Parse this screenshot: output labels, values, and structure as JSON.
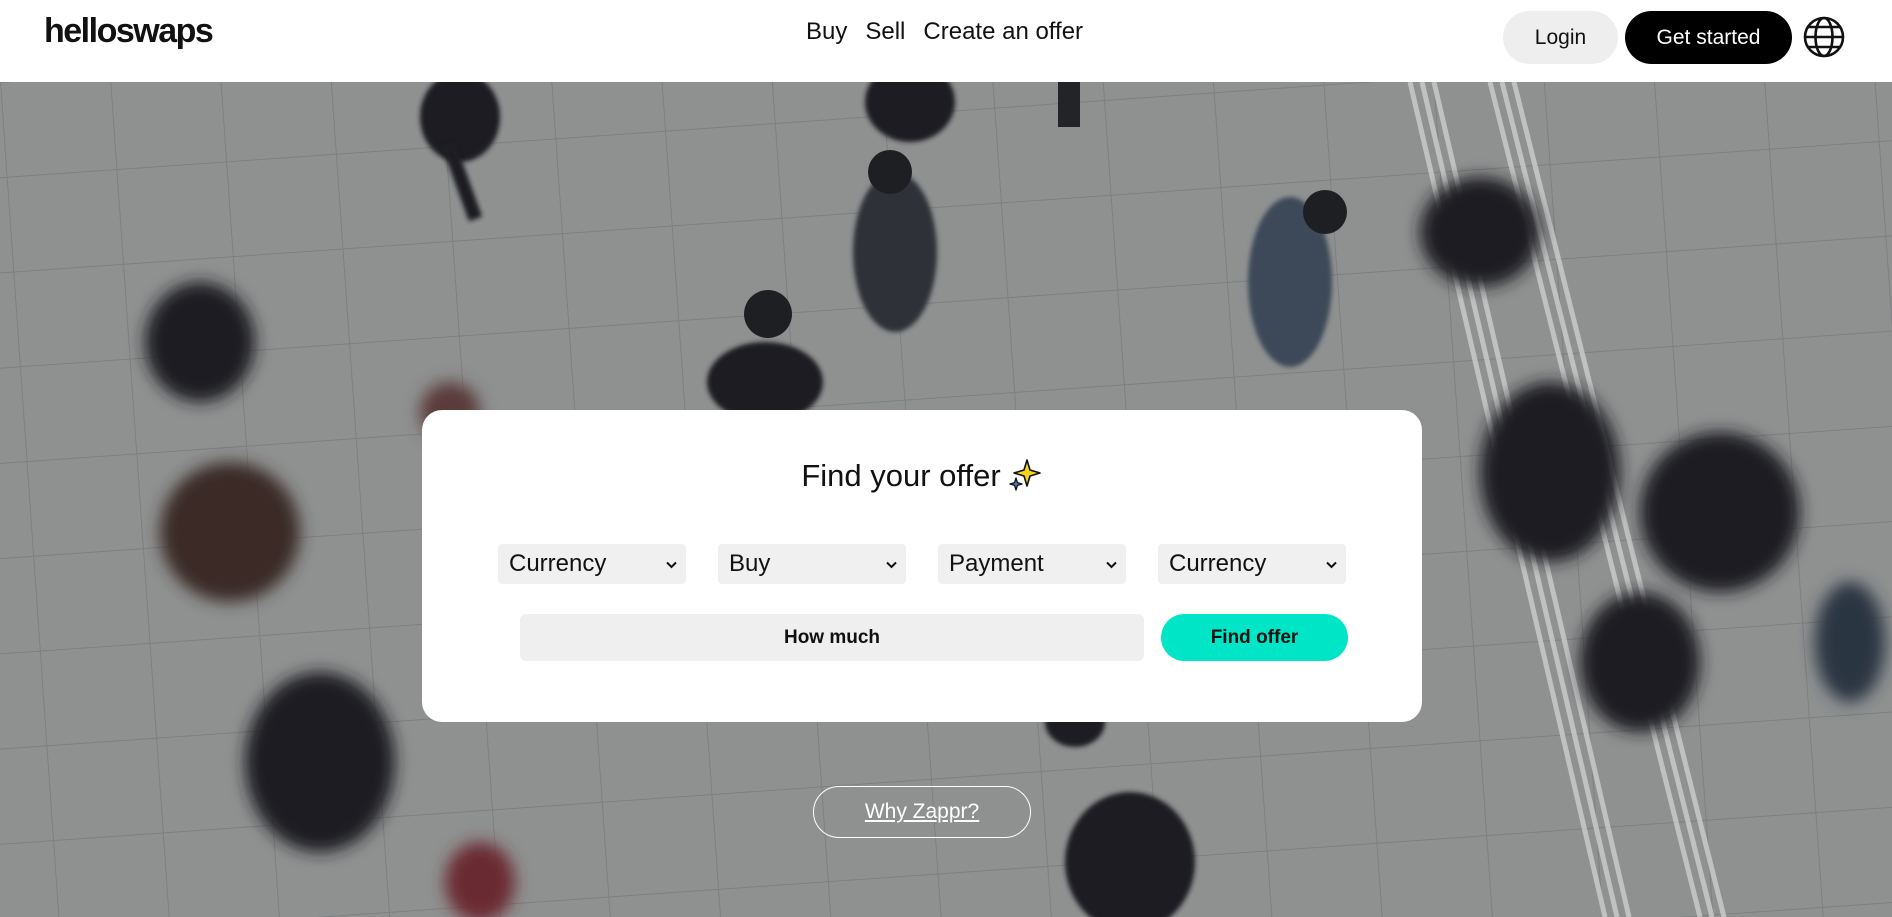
{
  "header": {
    "logo": "helloswaps",
    "nav": [
      "Buy",
      "Sell",
      "Create an offer"
    ],
    "login_label": "Login",
    "get_started_label": "Get started",
    "globe_icon": "globe-icon"
  },
  "search": {
    "title": "Find your offer",
    "title_icon": "sparkles-icon",
    "selects": [
      "Currency",
      "Buy",
      "Payment",
      "Currency"
    ],
    "amount_placeholder": "How much",
    "find_label": "Find offer"
  },
  "hero": {
    "why_label": "Why Zappr?"
  },
  "colors": {
    "accent": "#00e5c5",
    "primary_button": "#000000",
    "secondary_button": "#eeeeee"
  }
}
